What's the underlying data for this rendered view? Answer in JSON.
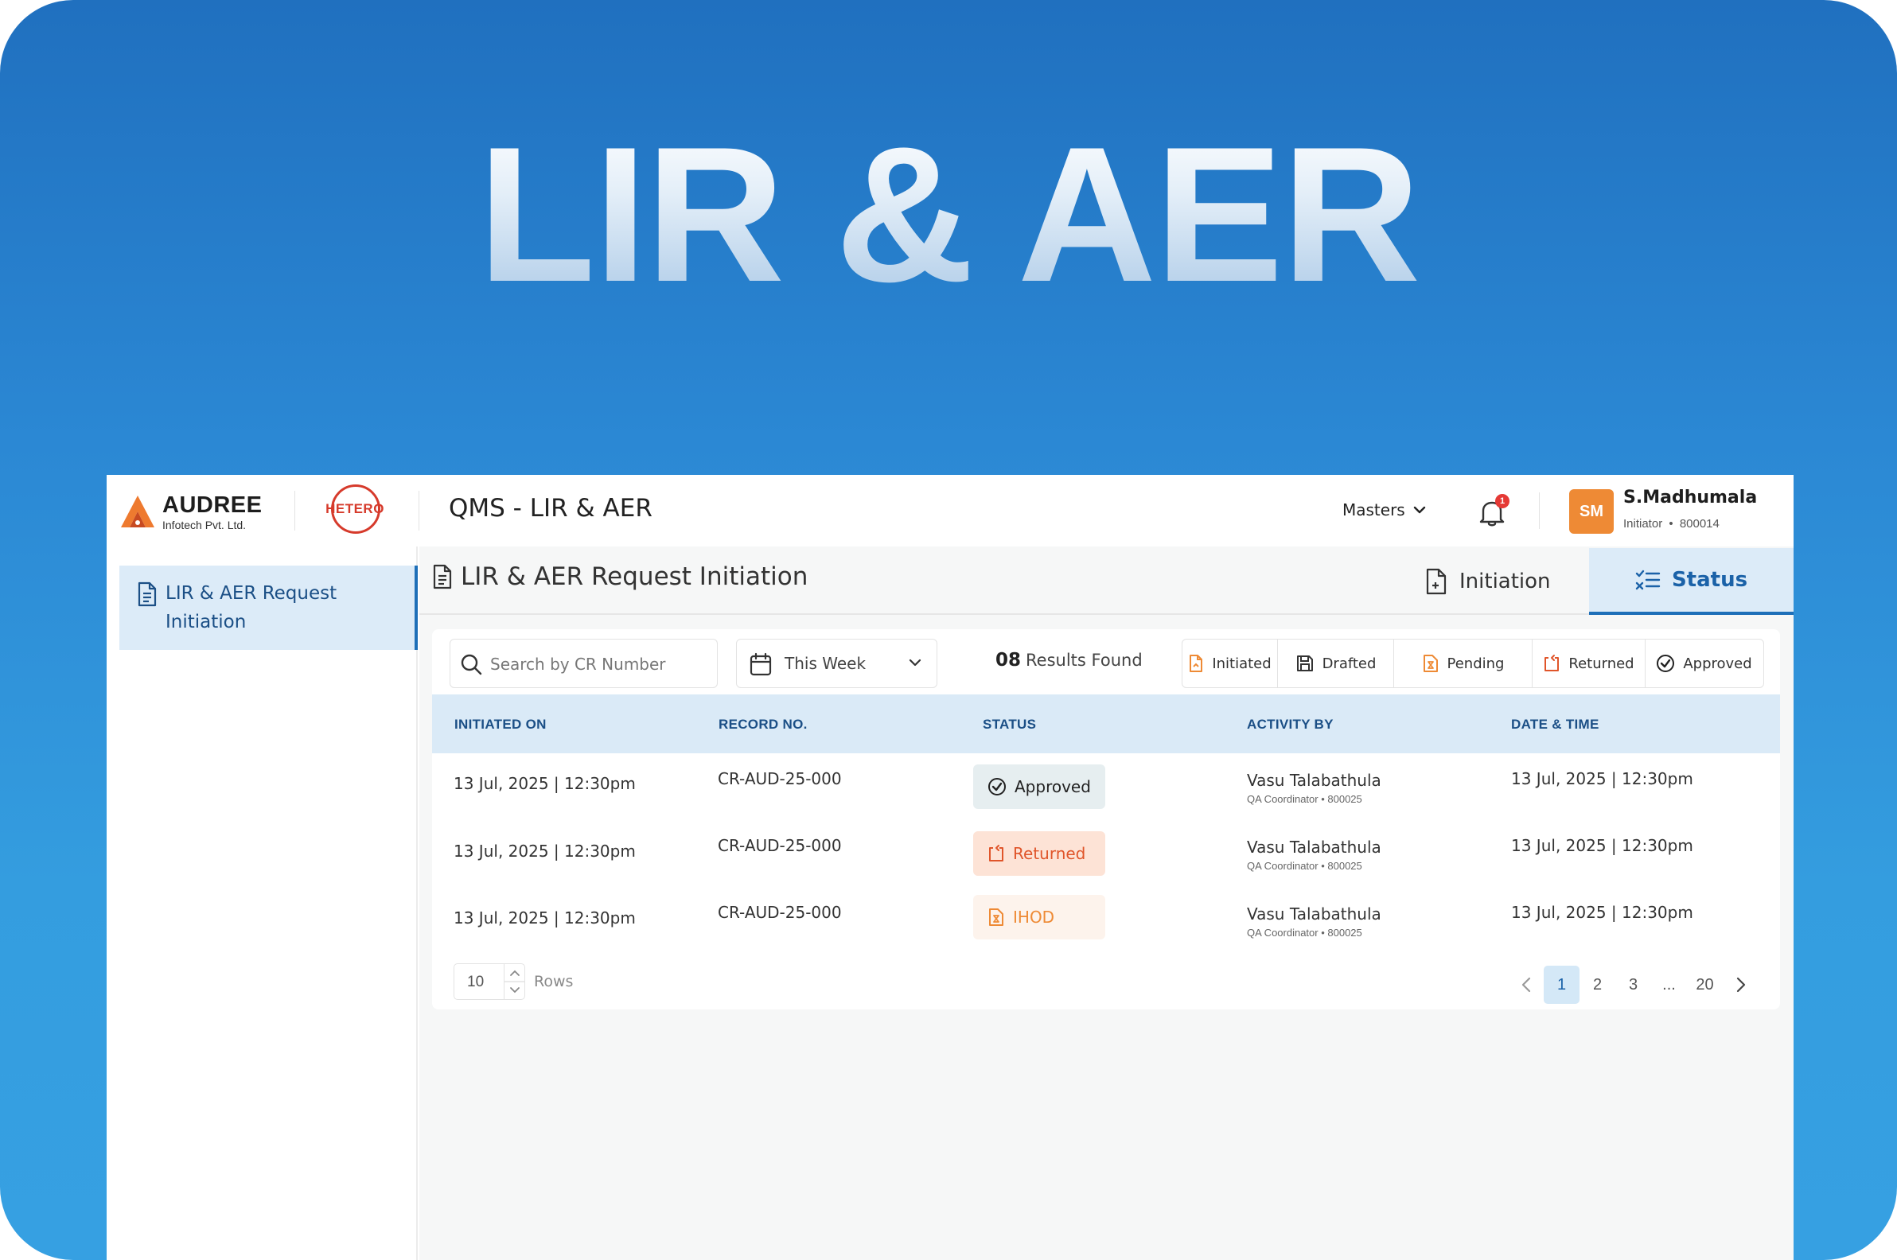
{
  "hero": {
    "title": "LIR & AER"
  },
  "header": {
    "company_name": "AUDREE",
    "company_sub": "Infotech Pvt. Ltd.",
    "partner_logo": "HETERO",
    "app_title": "QMS - LIR & AER",
    "masters_label": "Masters",
    "notification_count": "1",
    "user": {
      "initials": "SM",
      "name": "S.Madhumala",
      "role": "Initiator",
      "id": "800014"
    }
  },
  "sidebar": {
    "items": [
      {
        "label": "LIR & AER Request Initiation",
        "icon": "document-icon",
        "active": true
      }
    ]
  },
  "page": {
    "title": "LIR & AER Request Initiation",
    "tabs": [
      {
        "label": "Initiation",
        "icon": "file-plus-icon",
        "active": false
      },
      {
        "label": "Status",
        "icon": "checklist-icon",
        "active": true
      }
    ]
  },
  "toolbar": {
    "search_placeholder": "Search by CR Number",
    "period": "This Week",
    "results_count": "08",
    "results_label": "Results Found",
    "filters": [
      {
        "label": "Initiated",
        "icon": "file-initiated-icon",
        "color": "#ee8a35"
      },
      {
        "label": "Drafted",
        "icon": "save-icon",
        "color": "#333333"
      },
      {
        "label": "Pending",
        "icon": "hourglass-icon",
        "color": "#ee8a35"
      },
      {
        "label": "Returned",
        "icon": "return-icon",
        "color": "#e0552a"
      },
      {
        "label": "Approved",
        "icon": "check-circle-icon",
        "color": "#222222"
      }
    ]
  },
  "table": {
    "columns": [
      "INITIATED ON",
      "RECORD NO.",
      "STATUS",
      "ACTIVITY BY",
      "DATE & TIME"
    ],
    "rows": [
      {
        "initiated_on": "13 Jul, 2025 | 12:30pm",
        "record_no": "CR-AUD-25-000",
        "status": "Approved",
        "activity_name": "Vasu Talabathula",
        "activity_role": "QA Coordinator • 800025",
        "date_time": "13 Jul, 2025 | 12:30pm"
      },
      {
        "initiated_on": "13 Jul, 2025 | 12:30pm",
        "record_no": "CR-AUD-25-000",
        "status": "Returned",
        "activity_name": "Vasu Talabathula",
        "activity_role": "QA Coordinator • 800025",
        "date_time": "13 Jul, 2025 | 12:30pm"
      },
      {
        "initiated_on": "13 Jul, 2025 | 12:30pm",
        "record_no": "CR-AUD-25-000",
        "status": "IHOD",
        "activity_name": "Vasu Talabathula",
        "activity_role": "QA Coordinator • 800025",
        "date_time": "13 Jul, 2025 | 12:30pm"
      }
    ]
  },
  "footer": {
    "rows_value": "10",
    "rows_label": "Rows",
    "pages": [
      "1",
      "2",
      "3",
      "...",
      "20"
    ],
    "current_page": "1"
  },
  "colors": {
    "accent": "#1e6fb8",
    "brand_orange": "#ee8a35",
    "hetero_red": "#d63a2b"
  }
}
